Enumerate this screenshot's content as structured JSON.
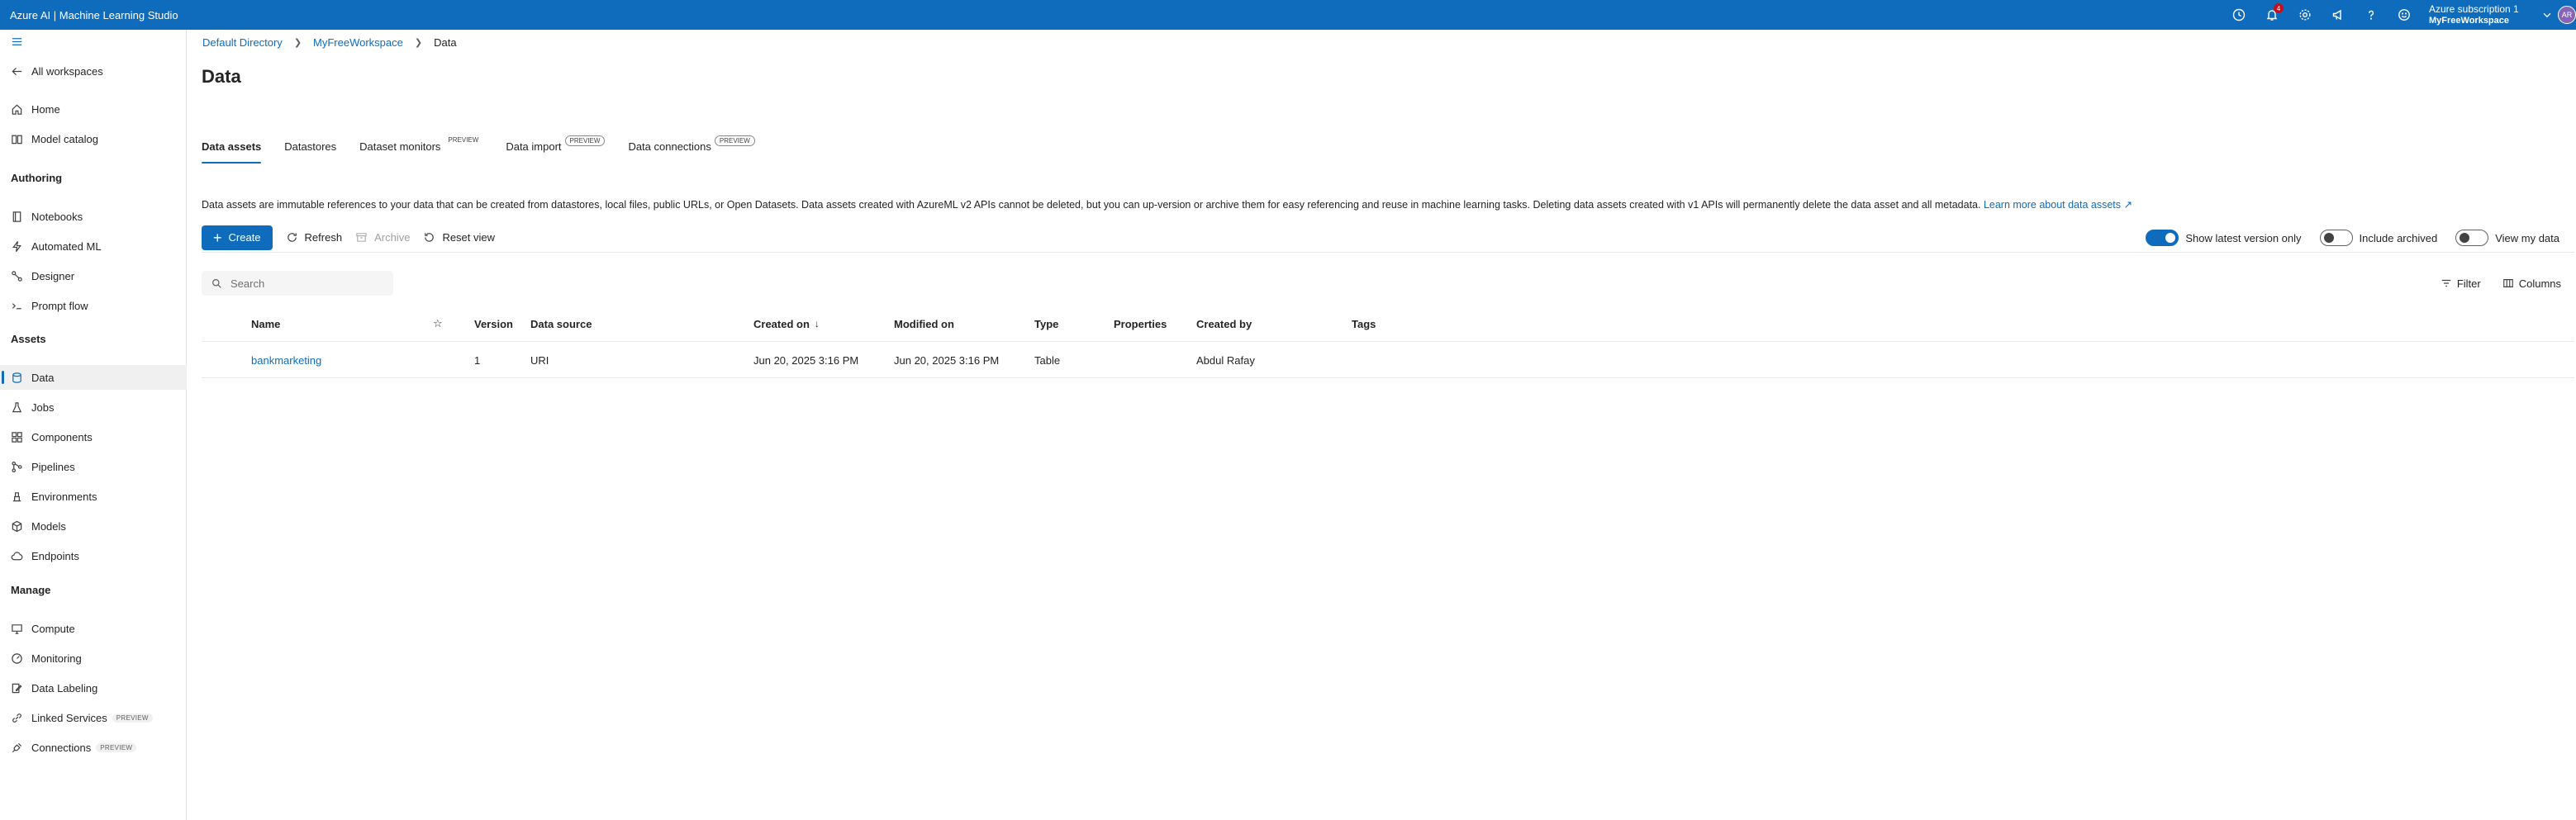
{
  "app": {
    "title": "Azure AI | Machine Learning Studio"
  },
  "topbar": {
    "notification_count": "4",
    "subscription": "Azure subscription 1",
    "workspace": "MyFreeWorkspace",
    "avatar_initials": "AR",
    "icons": [
      "history-icon",
      "bell-icon",
      "gear-icon",
      "megaphone-icon",
      "help-icon",
      "smiley-icon",
      "chevron-down-icon"
    ]
  },
  "sidebar": {
    "all_workspaces": "All workspaces",
    "home": "Home",
    "model_catalog": "Model catalog",
    "authoring": {
      "heading": "Authoring",
      "items": [
        "Notebooks",
        "Automated ML",
        "Designer",
        "Prompt flow"
      ]
    },
    "assets": {
      "heading": "Assets",
      "items": [
        "Data",
        "Jobs",
        "Components",
        "Pipelines",
        "Environments",
        "Models",
        "Endpoints"
      ]
    },
    "manage": {
      "heading": "Manage",
      "items": [
        "Compute",
        "Monitoring",
        "Data Labeling",
        "Linked Services",
        "Connections"
      ],
      "preview_label": "PREVIEW"
    },
    "active_item": "Data"
  },
  "breadcrumb": [
    "Default Directory",
    "MyFreeWorkspace",
    "Data"
  ],
  "page": {
    "title": "Data",
    "tabs": [
      {
        "label": "Data assets",
        "preview": ""
      },
      {
        "label": "Datastores",
        "preview": ""
      },
      {
        "label": "Dataset monitors",
        "preview": "PREVIEW"
      },
      {
        "label": "Data import",
        "preview": "PREVIEW"
      },
      {
        "label": "Data connections",
        "preview": "PREVIEW"
      }
    ],
    "active_tab": "Data assets",
    "description": "Data assets are immutable references to your data that can be created from datastores, local files, public URLs, or Open Datasets. Data assets created with AzureML v2 APIs cannot be deleted, but you can up-version or archive them for easy referencing and reuse in machine learning tasks. Deleting data assets created with v1 APIs will permanently delete the data asset and all metadata.",
    "learn_more": "Learn more about data assets"
  },
  "toolbar": {
    "create": "Create",
    "refresh": "Refresh",
    "archive": "Archive",
    "reset_view": "Reset view",
    "toggles": {
      "latest_version": {
        "label": "Show latest version only",
        "on": true
      },
      "include_archived": {
        "label": "Include archived",
        "on": false
      },
      "view_my_data": {
        "label": "View my data",
        "on": false
      }
    }
  },
  "search": {
    "placeholder": "Search"
  },
  "grid_tools": {
    "filter": "Filter",
    "columns": "Columns"
  },
  "table": {
    "headers": {
      "name": "Name",
      "version": "Version",
      "data_source": "Data source",
      "created_on": "Created on",
      "modified_on": "Modified on",
      "type": "Type",
      "properties": "Properties",
      "created_by": "Created by",
      "tags": "Tags"
    },
    "sort_indicator": "↓",
    "rows": [
      {
        "name": "bankmarketing",
        "version": "1",
        "data_source": "URI",
        "created_on": "Jun 20, 2025 3:16 PM",
        "modified_on": "Jun 20, 2025 3:16 PM",
        "type": "Table",
        "properties": "",
        "created_by": "Abdul Rafay",
        "tags": ""
      }
    ]
  }
}
